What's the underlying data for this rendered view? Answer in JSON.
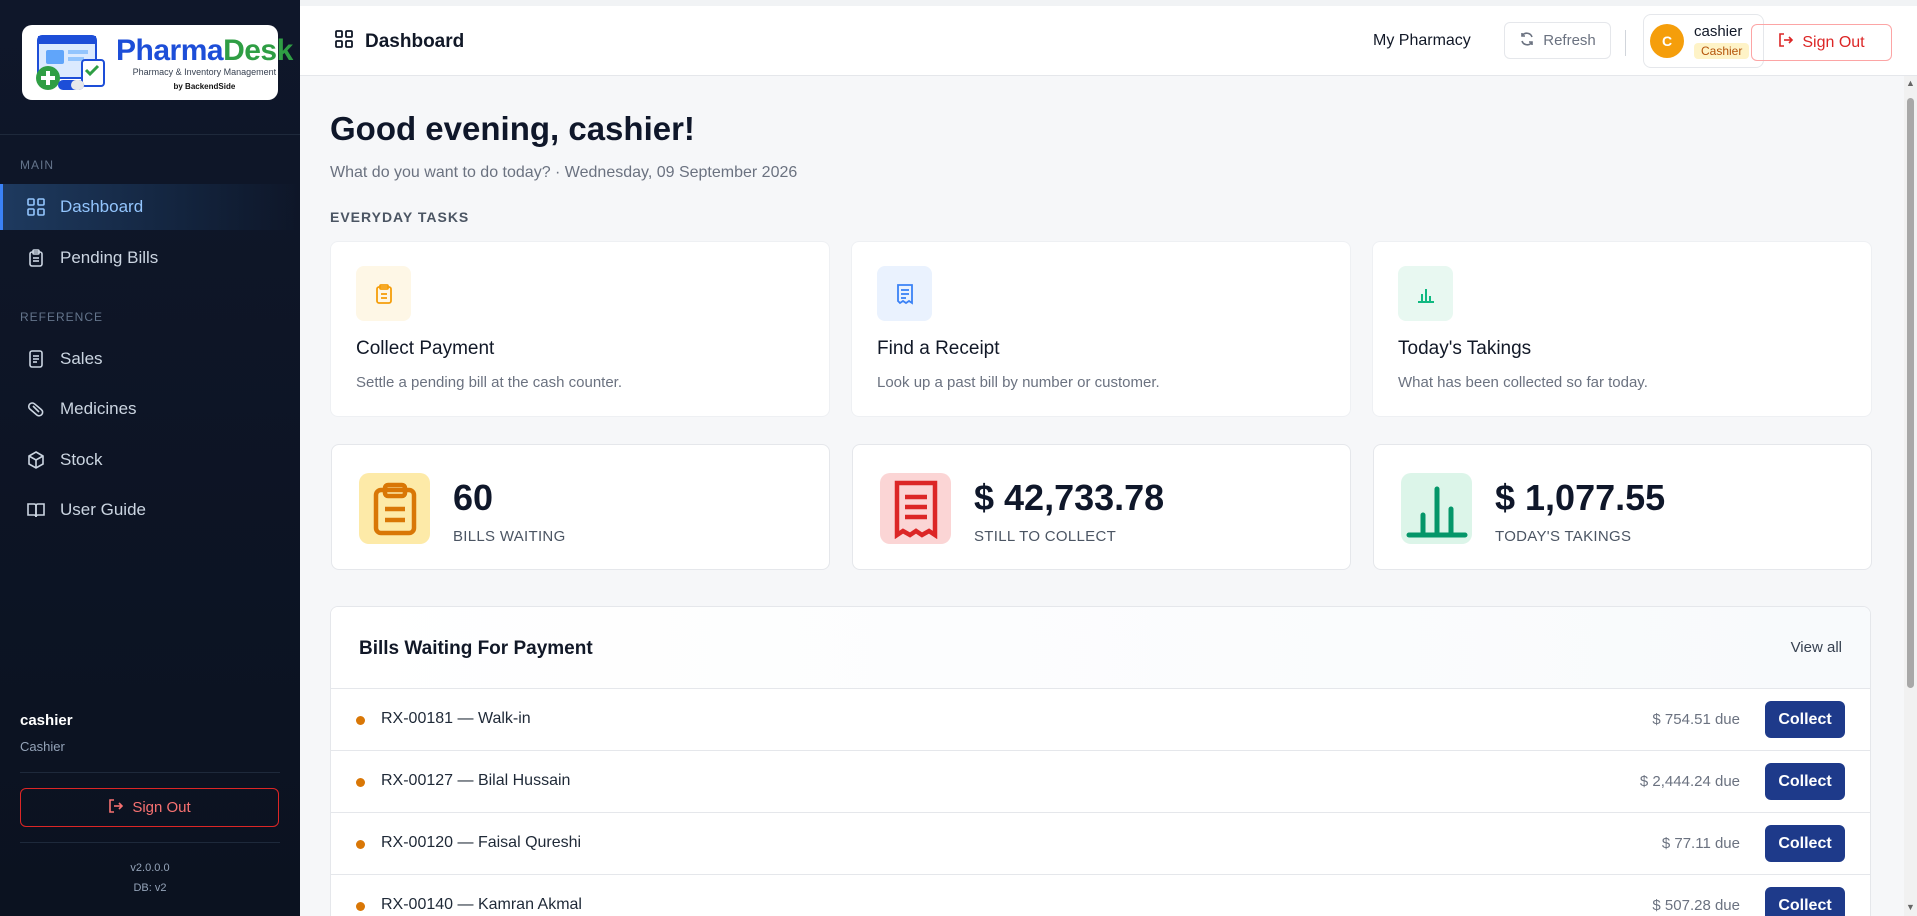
{
  "brand": {
    "name_part1": "Pharma",
    "name_part2": "Desk",
    "tagline": "Pharmacy & Inventory Management",
    "by": "by BackendSide"
  },
  "sidebar": {
    "sections": [
      {
        "label": "MAIN"
      },
      {
        "label": "REFERENCE"
      }
    ],
    "items": [
      {
        "label": "Dashboard",
        "icon": "grid-icon",
        "active": true
      },
      {
        "label": "Pending Bills",
        "icon": "clipboard-icon"
      },
      {
        "label": "Sales",
        "icon": "document-icon"
      },
      {
        "label": "Medicines",
        "icon": "pill-icon"
      },
      {
        "label": "Stock",
        "icon": "box-icon"
      },
      {
        "label": "User Guide",
        "icon": "book-icon"
      }
    ],
    "user": {
      "name": "cashier",
      "role": "Cashier"
    },
    "sign_out": "Sign Out",
    "version": "v2.0.0.0",
    "db": "DB: v2"
  },
  "header": {
    "title": "Dashboard",
    "pharmacy": "My Pharmacy",
    "refresh": "Refresh",
    "user": {
      "name": "cashier",
      "role": "Cashier",
      "initial": "C"
    },
    "sign_out": "Sign Out"
  },
  "main": {
    "greeting": "Good evening, cashier!",
    "subtitle": "What do you want to do today? · Wednesday, 09 September 2026",
    "section_label": "EVERYDAY TASKS",
    "tasks": [
      {
        "title": "Collect Payment",
        "desc": "Settle a pending bill at the cash counter.",
        "icon": "clipboard-icon",
        "color": "#f59e0b"
      },
      {
        "title": "Find a Receipt",
        "desc": "Look up a past bill by number or customer.",
        "icon": "receipt-icon",
        "color": "#3b82f6"
      },
      {
        "title": "Today's Takings",
        "desc": "What has been collected so far today.",
        "icon": "bar-chart-icon",
        "color": "#10b981"
      }
    ],
    "stats": [
      {
        "value": "60",
        "label": "BILLS WAITING",
        "icon": "clipboard-icon"
      },
      {
        "value": "$ 42,733.78",
        "label": "STILL TO COLLECT",
        "icon": "receipt-icon"
      },
      {
        "value": "$ 1,077.55",
        "label": "TODAY'S TAKINGS",
        "icon": "bar-chart-icon"
      }
    ],
    "bills": {
      "title": "Bills Waiting For Payment",
      "view_all": "View all",
      "collect_label": "Collect",
      "rows": [
        {
          "text": "RX-00181 — Walk-in",
          "due": "$ 754.51 due"
        },
        {
          "text": "RX-00127 — Bilal Hussain",
          "due": "$ 2,444.24 due"
        },
        {
          "text": "RX-00120 — Faisal Qureshi",
          "due": "$ 77.11 due"
        },
        {
          "text": "RX-00140 — Kamran Akmal",
          "due": "$ 507.28 due"
        }
      ]
    }
  },
  "colors": {
    "accent": "#1e3a8a",
    "warning": "#f59e0b",
    "danger": "#dc2626",
    "success": "#10b981"
  }
}
